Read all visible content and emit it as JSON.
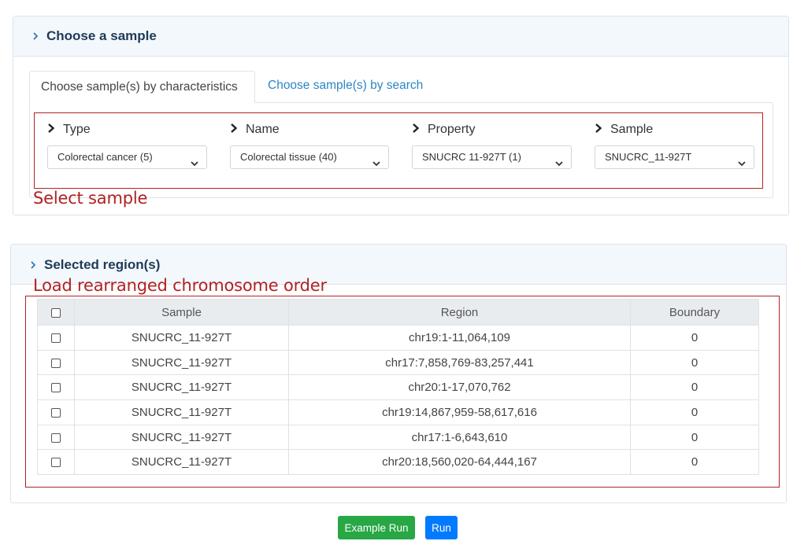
{
  "choose_sample": {
    "title": "Choose a sample",
    "tabs": [
      {
        "label": "Choose sample(s) by characteristics",
        "active": true
      },
      {
        "label": "Choose sample(s) by search",
        "active": false
      }
    ],
    "fields": [
      {
        "label": "Type",
        "value": "Colorectal cancer (5)"
      },
      {
        "label": "Name",
        "value": "Colorectal tissue (40)"
      },
      {
        "label": "Property",
        "value": "SNUCRC 11-927T (1)"
      },
      {
        "label": "Sample",
        "value": "SNUCRC_11-927T"
      }
    ],
    "annotation": "Select sample"
  },
  "selected_regions": {
    "title": "Selected region(s)",
    "annotation": "Load rearranged chromosome order",
    "columns": [
      "Sample",
      "Region",
      "Boundary"
    ],
    "rows": [
      {
        "sample": "SNUCRC_11-927T",
        "region": "chr19:1-11,064,109",
        "boundary": "0"
      },
      {
        "sample": "SNUCRC_11-927T",
        "region": "chr17:7,858,769-83,257,441",
        "boundary": "0"
      },
      {
        "sample": "SNUCRC_11-927T",
        "region": "chr20:1-17,070,762",
        "boundary": "0"
      },
      {
        "sample": "SNUCRC_11-927T",
        "region": "chr19:14,867,959-58,617,616",
        "boundary": "0"
      },
      {
        "sample": "SNUCRC_11-927T",
        "region": "chr17:1-6,643,610",
        "boundary": "0"
      },
      {
        "sample": "SNUCRC_11-927T",
        "region": "chr20:18,560,020-64,444,167",
        "boundary": "0"
      }
    ]
  },
  "buttons": {
    "example_run": "Example Run",
    "run": "Run"
  },
  "colors": {
    "accent_blue": "#2b86c5",
    "annotation_red": "#b22222",
    "example_run_green": "#28a745",
    "run_blue": "#007bff"
  }
}
